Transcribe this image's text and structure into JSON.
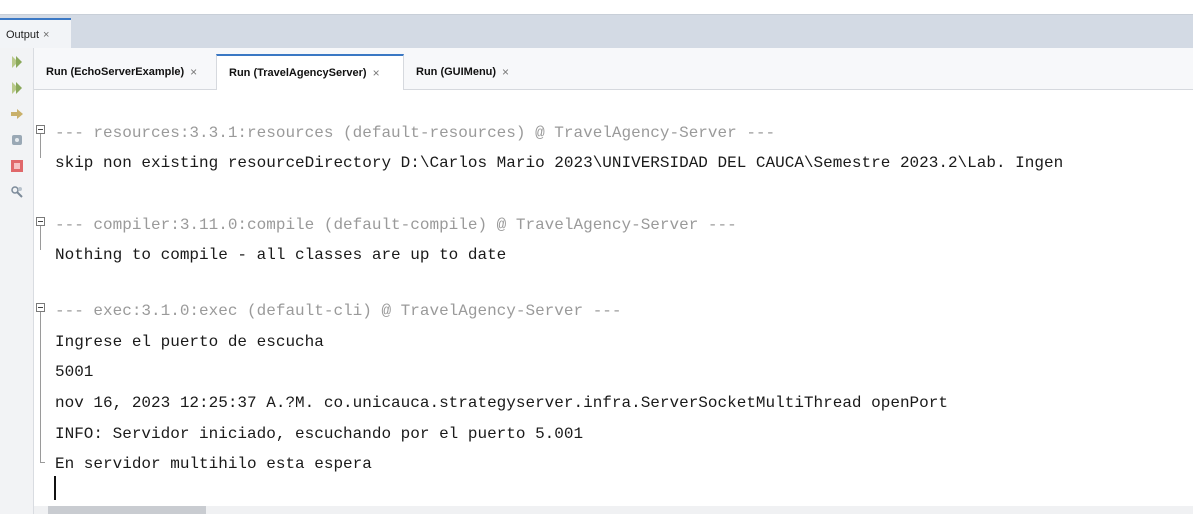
{
  "window": {
    "tab_label": "Output",
    "tab_close": "×"
  },
  "toolbar": {
    "icons": [
      "rerun-icon",
      "rerun-with-params-icon",
      "step-over-icon",
      "settings-icon",
      "stop-icon",
      "tools-icon"
    ]
  },
  "run_tabs": [
    {
      "label": "Run (EchoServerExample)",
      "close": "×",
      "active": false
    },
    {
      "label": "Run (TravelAgencyServer)",
      "close": "×",
      "active": true
    },
    {
      "label": "Run (GUIMenu)",
      "close": "×",
      "active": false
    }
  ],
  "console": {
    "lines": [
      {
        "text": "--- resources:3.3.1:resources (default-resources) @ TravelAgency-Server ---",
        "style": "header"
      },
      {
        "text": "skip non existing resourceDirectory D:\\Carlos Mario 2023\\UNIVERSIDAD DEL CAUCA\\Semestre 2023.2\\Lab. Ingen",
        "style": "normal"
      },
      {
        "text": "--- compiler:3.11.0:compile (default-compile) @ TravelAgency-Server ---",
        "style": "header"
      },
      {
        "text": "Nothing to compile - all classes are up to date",
        "style": "normal"
      },
      {
        "text": "--- exec:3.1.0:exec (default-cli) @ TravelAgency-Server ---",
        "style": "header"
      },
      {
        "text": "Ingrese el puerto de escucha",
        "style": "normal"
      },
      {
        "text": "5001",
        "style": "normal"
      },
      {
        "text": "nov 16, 2023 12:25:37 A.?M. co.unicauca.strategyserver.infra.ServerSocketMultiThread openPort",
        "style": "normal"
      },
      {
        "text": "INFO: Servidor iniciado, escuchando por el puerto 5.001",
        "style": "normal"
      },
      {
        "text": "En servidor multihilo esta espera",
        "style": "normal"
      }
    ]
  }
}
